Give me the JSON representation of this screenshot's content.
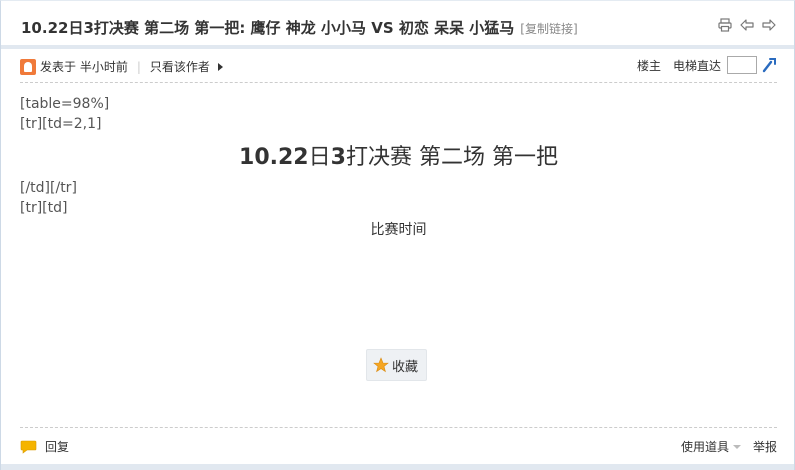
{
  "thread": {
    "title": "10.22日3打决赛 第二场 第一把: 鹰仔 神龙 小小马 VS 初恋 呆呆 小猛马",
    "copy_link": "[复制链接]"
  },
  "author_bar": {
    "posted": "发表于 半小时前",
    "only_author": "只看该作者",
    "floor_owner": "楼主",
    "elevator": "电梯直达"
  },
  "content": {
    "raw_line1": "[table=98%]",
    "raw_line2": "[tr][td=2,1]",
    "heading_part1": "10.22",
    "heading_part2": "日",
    "heading_part3": "3",
    "heading_part4": "打决赛  第二场  第一把",
    "raw_line3": "[/td][/tr]",
    "raw_line4": "[tr][td]",
    "match_time": "比赛时间"
  },
  "actions": {
    "favorite": "收藏"
  },
  "footer": {
    "reply": "回复",
    "use_tools": "使用道具",
    "report": "举报"
  },
  "icons": {
    "print": "print-icon",
    "prev": "prev-thread-icon",
    "next": "next-thread-icon",
    "author": "author-icon",
    "go": "go-icon",
    "star": "star-icon",
    "reply": "reply-icon"
  },
  "colors": {
    "border": "#cdd9e6",
    "author_icon": "#f07a3a",
    "star": "#f5a623",
    "reply_icon": "#f5b400",
    "go_icon": "#2a6bbf"
  }
}
